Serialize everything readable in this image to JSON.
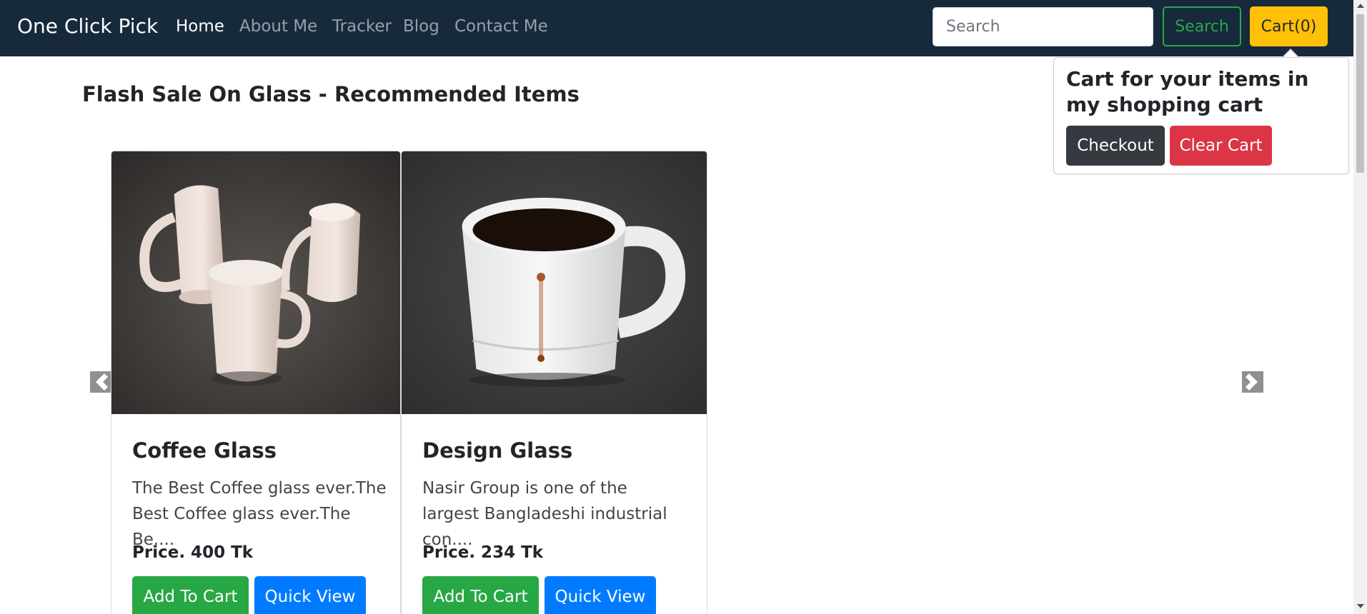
{
  "navbar": {
    "brand": "One Click Pick",
    "links": [
      {
        "label": "Home",
        "active": true
      },
      {
        "label": "About Me",
        "active": false
      },
      {
        "label": "Tracker",
        "active": false
      },
      {
        "label": "Blog",
        "active": false
      },
      {
        "label": "Contact Me",
        "active": false
      }
    ],
    "search": {
      "placeholder": "Search",
      "value": ""
    },
    "search_button": "Search",
    "cart_button": "Cart(0)"
  },
  "cart_popover": {
    "title": "Cart for your items in my shopping cart",
    "checkout": "Checkout",
    "clear": "Clear Cart"
  },
  "section": {
    "title": "Flash Sale On Glass - Recommended Items"
  },
  "carousel": {
    "prev_icon": "chevron-left-icon",
    "next_icon": "chevron-right-icon"
  },
  "products": [
    {
      "name": "Coffee Glass",
      "description": "The Best Coffee glass ever.The Best Coffee glass ever.The Be....",
      "price": "Price. 400 Tk",
      "image": "three-white-mugs",
      "add_label": "Add To Cart",
      "quick_label": "Quick View"
    },
    {
      "name": "Design Glass",
      "description": "Nasir Group is one of the largest Bangladeshi industrial con....",
      "price": "Price. 234 Tk",
      "image": "coffee-mug-with-drip",
      "add_label": "Add To Cart",
      "quick_label": "Quick View"
    }
  ],
  "colors": {
    "navbar_bg": "#172a3c",
    "success": "#28a745",
    "warning": "#ffc107",
    "primary": "#007bff",
    "danger": "#dc3545",
    "dark": "#343a40"
  }
}
